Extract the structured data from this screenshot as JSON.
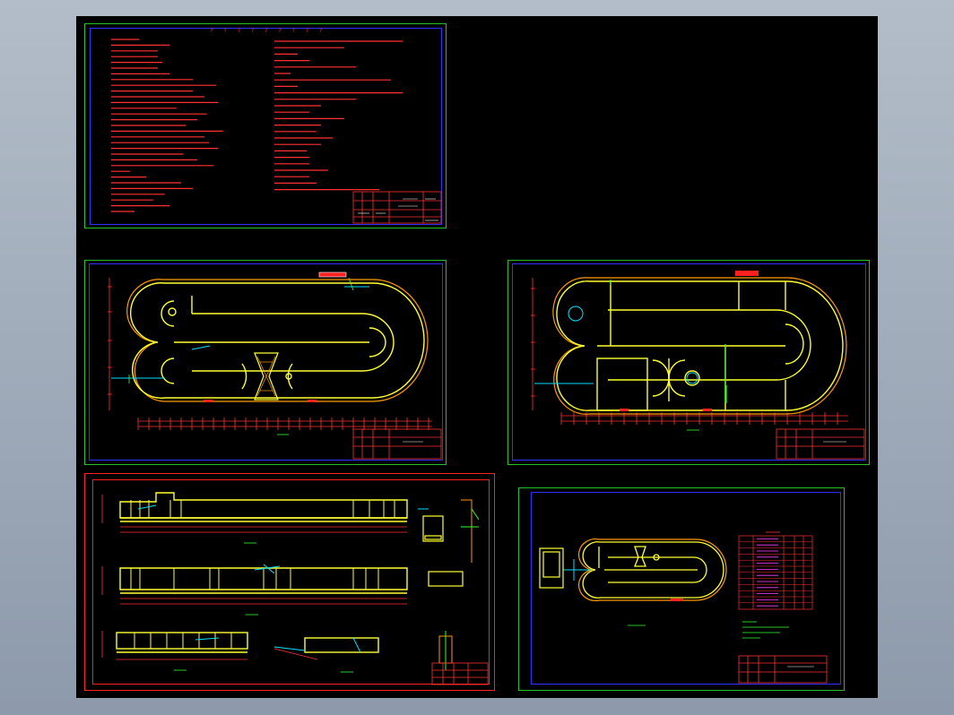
{
  "app": {
    "window_title": "",
    "background": "#000000"
  },
  "sheets": {
    "notes": {
      "title": "? ? ? ? ? ? ? ? ?",
      "frame_color": "#22c022",
      "border_color": "#3030ff"
    },
    "plan1": {
      "caption": "",
      "frame_color": "#22c022"
    },
    "plan2": {
      "caption": "",
      "frame_color": "#22c022"
    },
    "sections": {
      "frame_color": "#ff2020"
    },
    "plan3": {
      "caption": "",
      "frame_color": "#22c022",
      "table_header": ""
    }
  },
  "colors": {
    "wall": "#ffff30",
    "outline": "#ff9a00",
    "text_red": "#ff3030",
    "dim": "#ff3030",
    "pipe": "#00e0ff",
    "green": "#30ff30",
    "magenta": "#ff40ff",
    "blue": "#3030ff"
  }
}
